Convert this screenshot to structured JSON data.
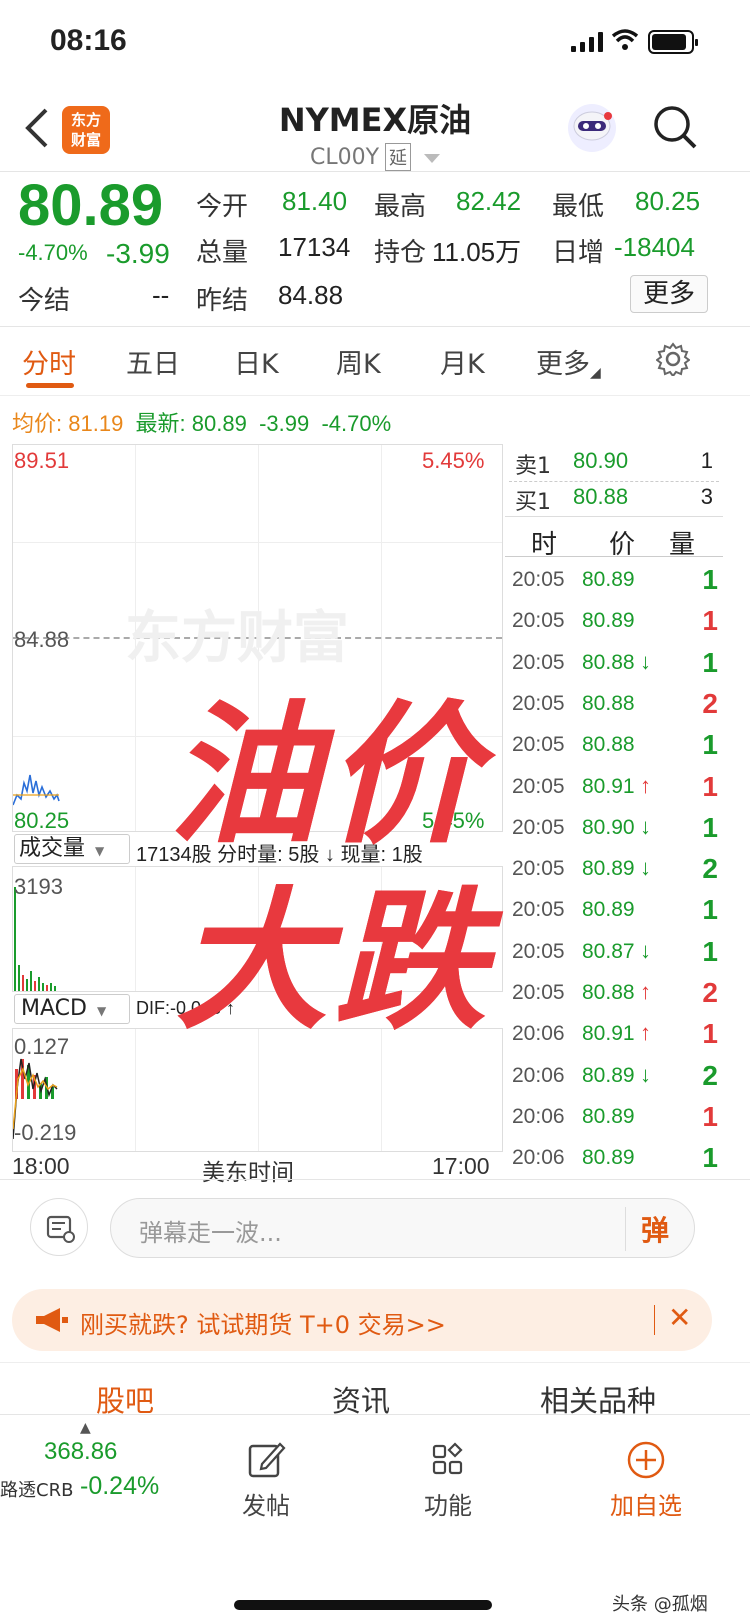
{
  "status_bar": {
    "time": "08:16"
  },
  "header": {
    "title": "NYMEX原油",
    "code": "CL00Y",
    "delayed_badge": "延",
    "logo_text": "东方\n财富"
  },
  "quote": {
    "price": "80.89",
    "change_pct": "-4.70%",
    "change": "-3.99",
    "stats": [
      {
        "label": "今开",
        "value": "81.40"
      },
      {
        "label": "最高",
        "value": "82.42"
      },
      {
        "label": "最低",
        "value": "80.25"
      },
      {
        "label": "总量",
        "value": "17134"
      },
      {
        "label": "持仓",
        "value": "11.05万"
      },
      {
        "label": "日增",
        "value": "-18404"
      },
      {
        "label": "今结",
        "value": "--"
      },
      {
        "label": "昨结",
        "value": "84.88"
      }
    ],
    "more_label": "更多"
  },
  "tabs": [
    "分时",
    "五日",
    "日K",
    "周K",
    "月K",
    "更多"
  ],
  "chart": {
    "avg_label": "均价:",
    "avg_value": "81.19",
    "latest_label": "最新:",
    "latest_value": "80.89",
    "latest_change": "-3.99",
    "latest_pct": "-4.70%",
    "y_high": "89.51",
    "y_high_pct": "5.45%",
    "y_mid": "84.88",
    "y_low": "80.25",
    "y_low_pct": "5.45%",
    "watermark": "东方财富",
    "volume_selector": "成交量",
    "volume_info": "17134股 分时量: 5股 ↓ 现量: 1股",
    "volume_max": "3193",
    "macd_selector": "MACD",
    "macd_info": "DIF:-0.048 ↑",
    "macd_high": "0.127",
    "macd_low": "-0.219",
    "time_start": "18:00",
    "time_label": "美东时间",
    "time_end": "17:00"
  },
  "order_book": {
    "sell": {
      "label": "卖1",
      "price": "80.90",
      "qty": "1"
    },
    "buy": {
      "label": "买1",
      "price": "80.88",
      "qty": "3"
    },
    "headers": [
      "时",
      "价",
      "量"
    ]
  },
  "trades": [
    {
      "time": "20:05",
      "price": "80.89",
      "arrow": "",
      "vol": "1",
      "vcolor": "green"
    },
    {
      "time": "20:05",
      "price": "80.89",
      "arrow": "",
      "vol": "1",
      "vcolor": "red"
    },
    {
      "time": "20:05",
      "price": "80.88",
      "arrow": "↓",
      "vol": "1",
      "vcolor": "green"
    },
    {
      "time": "20:05",
      "price": "80.88",
      "arrow": "",
      "vol": "2",
      "vcolor": "red"
    },
    {
      "time": "20:05",
      "price": "80.88",
      "arrow": "",
      "vol": "1",
      "vcolor": "green"
    },
    {
      "time": "20:05",
      "price": "80.91",
      "arrow": "↑",
      "vol": "1",
      "vcolor": "red"
    },
    {
      "time": "20:05",
      "price": "80.90",
      "arrow": "↓",
      "vol": "1",
      "vcolor": "green"
    },
    {
      "time": "20:05",
      "price": "80.89",
      "arrow": "↓",
      "vol": "2",
      "vcolor": "green"
    },
    {
      "time": "20:05",
      "price": "80.89",
      "arrow": "",
      "vol": "1",
      "vcolor": "green"
    },
    {
      "time": "20:05",
      "price": "80.87",
      "arrow": "↓",
      "vol": "1",
      "vcolor": "green"
    },
    {
      "time": "20:05",
      "price": "80.88",
      "arrow": "↑",
      "vol": "2",
      "vcolor": "red"
    },
    {
      "time": "20:06",
      "price": "80.91",
      "arrow": "↑",
      "vol": "1",
      "vcolor": "red"
    },
    {
      "time": "20:06",
      "price": "80.89",
      "arrow": "↓",
      "vol": "2",
      "vcolor": "green"
    },
    {
      "time": "20:06",
      "price": "80.89",
      "arrow": "",
      "vol": "1",
      "vcolor": "red"
    },
    {
      "time": "20:06",
      "price": "80.89",
      "arrow": "",
      "vol": "1",
      "vcolor": "green"
    }
  ],
  "overlay": {
    "line1": "油价",
    "line2": "大跌"
  },
  "danmu": {
    "placeholder": "弹幕走一波...",
    "button": "弹"
  },
  "promo": {
    "text": "刚买就跌? 试试期货 T+0 交易>>"
  },
  "sub_tabs": [
    "股吧",
    "资讯",
    "相关品种"
  ],
  "bottom_nav": {
    "index_value": "368.86",
    "index_name": "路透CRB",
    "index_change": "-0.24%",
    "post": "发帖",
    "functions": "功能",
    "add_watch": "加自选"
  },
  "watermark_footer": "头条 @孤烟",
  "colors": {
    "up": "#e23a3a",
    "down": "#1a9b2c",
    "accent": "#e05a12"
  }
}
